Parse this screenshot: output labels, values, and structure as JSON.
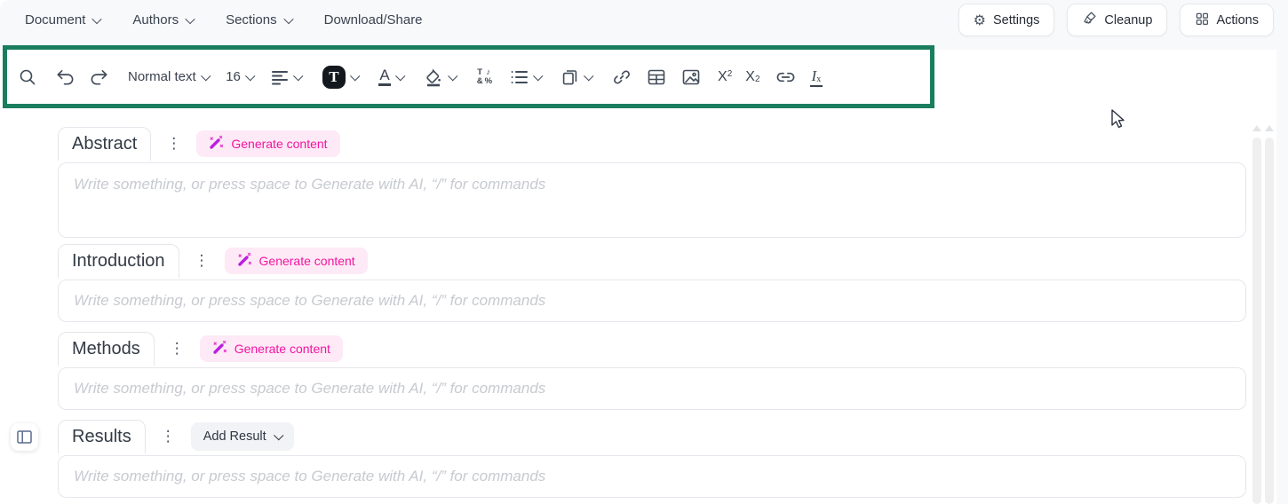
{
  "menu_bar": {
    "items": [
      {
        "label": "Document"
      },
      {
        "label": "Authors"
      },
      {
        "label": "Sections"
      }
    ],
    "download_share_label": "Download/Share"
  },
  "header_actions": {
    "settings_label": "Settings",
    "cleanup_label": "Cleanup",
    "actions_label": "Actions"
  },
  "toolbar": {
    "paragraph_style": "Normal text",
    "font_size": "16",
    "text_style_badge": "T",
    "font_color_letter": "A",
    "special_chars": {
      "c1": "T",
      "c2": "♪",
      "c3": "&",
      "c4": "%"
    },
    "superscript": {
      "base": "X",
      "script": "2"
    },
    "subscript": {
      "base": "X",
      "script": "2"
    },
    "clear_format": {
      "base": "I",
      "script": "x"
    }
  },
  "icons": {
    "kebab": "⋮",
    "gear": "⚙"
  },
  "sections": [
    {
      "title": "Abstract",
      "action_label": "Generate content",
      "placeholder": "Write something, or press space to Generate with AI, “/” for commands"
    },
    {
      "title": "Introduction",
      "action_label": "Generate content",
      "placeholder": "Write something, or press space to Generate with AI, “/” for commands"
    },
    {
      "title": "Methods",
      "action_label": "Generate content",
      "placeholder": "Write something, or press space to Generate with AI, “/” for commands"
    },
    {
      "title": "Results",
      "action_label": "Add Result",
      "placeholder": "Write something, or press space to Generate with AI, “/” for commands"
    }
  ],
  "colors": {
    "accent_green": "#1a7e5e",
    "accent_pink_text": "#f315a2",
    "accent_pink_bg": "#fdeaf6",
    "wand_purple": "#bc1ee0",
    "header_bg": "#f8f9fb"
  }
}
